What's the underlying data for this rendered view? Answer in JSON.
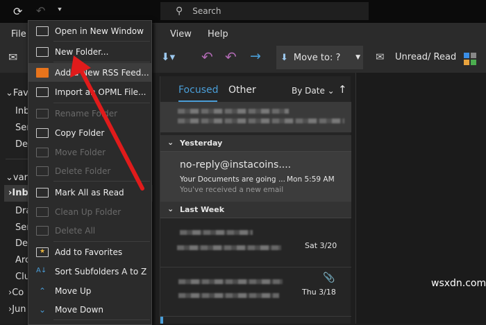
{
  "titlebar": {
    "search_placeholder": "Search"
  },
  "ribbon": {
    "tabs": [
      "File",
      "View",
      "Help"
    ],
    "move_to": "Move to: ?",
    "unread_read": "Unread/ Read"
  },
  "folders": {
    "items": [
      "Fav",
      "Inb",
      "Ser",
      "Del",
      "var",
      "Inb",
      "Dra",
      "Ser",
      "Del",
      "Arc",
      "Clu",
      "Co",
      "Jun"
    ]
  },
  "list": {
    "tab_focused": "Focused",
    "tab_other": "Other",
    "sort": "By Date",
    "groups": {
      "yesterday": "Yesterday",
      "last_week": "Last Week"
    },
    "selected": {
      "sender": "no-reply@instacoins....",
      "subject": "Your Documents are going ...",
      "time": "Mon 5:59 AM",
      "preview": "You've received a new email"
    },
    "dates": [
      "Sat 3/20",
      "Thu 3/18"
    ]
  },
  "context_menu": {
    "items": [
      {
        "label": "Open in New Window",
        "icon": "open-window-icon",
        "disabled": false
      },
      {
        "label": "New Folder...",
        "icon": "folder-icon",
        "disabled": false
      },
      {
        "label": "Add a New RSS Feed...",
        "icon": "rss-icon",
        "disabled": false
      },
      {
        "label": "Import an OPML File...",
        "icon": "import-icon",
        "disabled": false
      },
      {
        "label": "Rename Folder",
        "icon": "rename-folder-icon",
        "disabled": true
      },
      {
        "label": "Copy Folder",
        "icon": "copy-folder-icon",
        "disabled": false
      },
      {
        "label": "Move Folder",
        "icon": "move-folder-icon",
        "disabled": true
      },
      {
        "label": "Delete Folder",
        "icon": "delete-folder-icon",
        "disabled": true
      },
      {
        "label": "Mark All as Read",
        "icon": "envelope-open-icon",
        "disabled": false
      },
      {
        "label": "Clean Up Folder",
        "icon": "clean-up-icon",
        "disabled": true
      },
      {
        "label": "Delete All",
        "icon": "delete-all-icon",
        "disabled": true
      },
      {
        "label": "Add to Favorites",
        "icon": "star-folder-icon",
        "disabled": false
      },
      {
        "label": "Sort Subfolders A to Z",
        "icon": "sort-az-icon",
        "disabled": false
      },
      {
        "label": "Move Up",
        "icon": "chevron-up-icon",
        "disabled": false
      },
      {
        "label": "Move Down",
        "icon": "chevron-down-icon",
        "disabled": false
      }
    ]
  },
  "watermark": "wsxdn.com",
  "colors": {
    "accent": "#4a9ed8",
    "arrow": "#e01b1b",
    "reply": "#b06ab3"
  }
}
